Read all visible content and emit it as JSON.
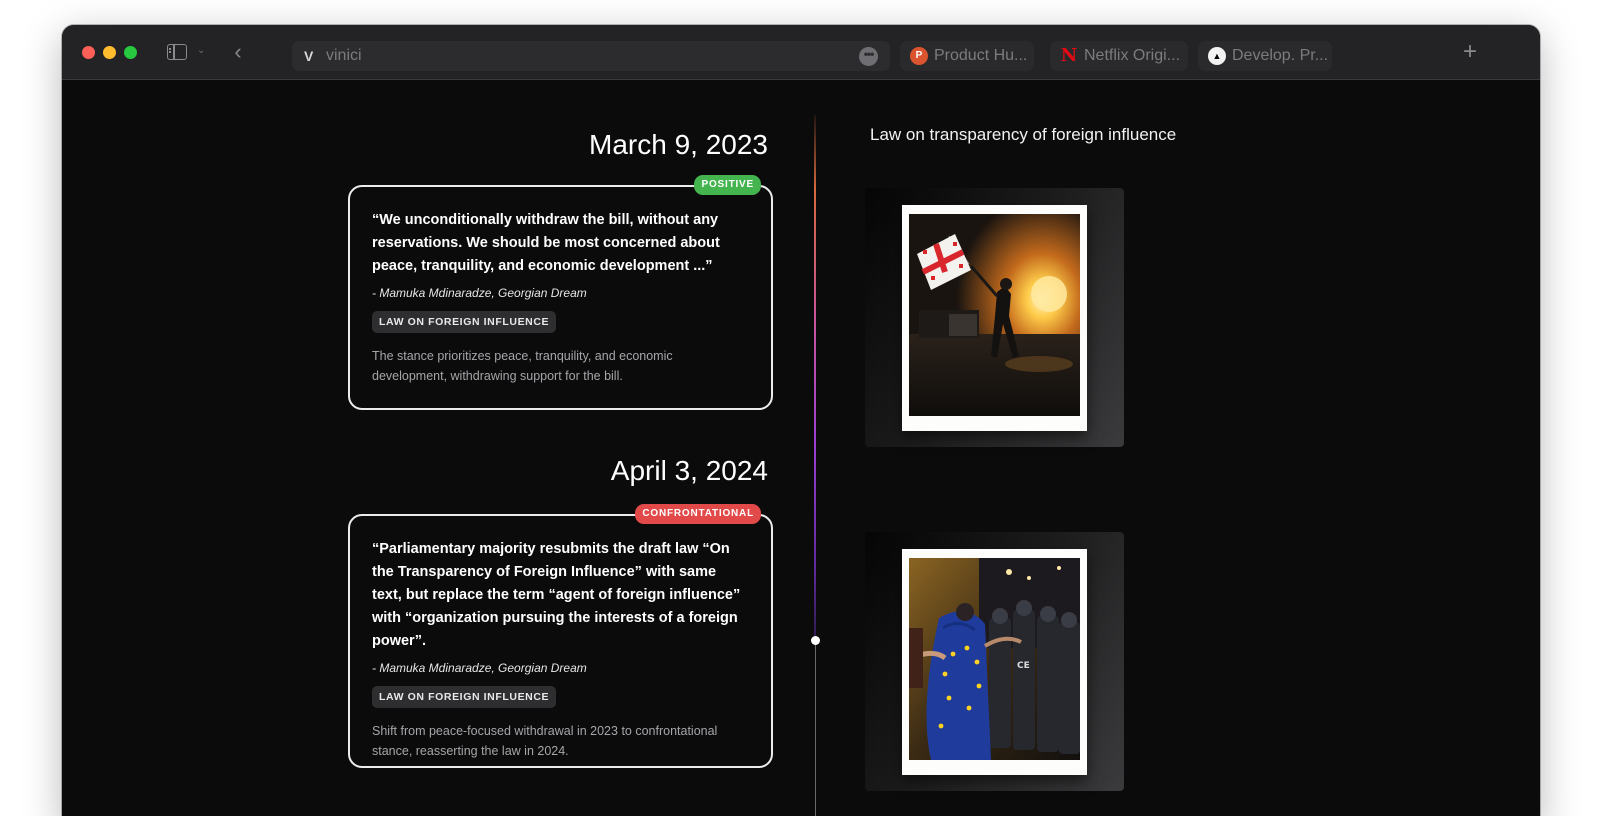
{
  "browser": {
    "address": "vinici",
    "site_icon": "V",
    "tabs": [
      {
        "label": "Product Hu...",
        "icon": "P",
        "icon_name": "product-hunt-icon",
        "color": "#da552f"
      },
      {
        "label": "Netflix Origi...",
        "icon": "N",
        "icon_name": "netflix-icon",
        "color": "#e50914"
      },
      {
        "label": "Develop. Pr...",
        "icon": "▲",
        "icon_name": "vercel-icon",
        "color": "#000000"
      }
    ],
    "new_tab": "+",
    "back": "‹",
    "more": "•••"
  },
  "section": {
    "title": "Law on transparency of foreign influence"
  },
  "entries": [
    {
      "date": "March 9, 2023",
      "badge": "POSITIVE",
      "badge_color": "#44b44e",
      "quote": "“We unconditionally withdraw the bill, without any reservations. We should be most concerned about peace, tranquility, and economic development ...”",
      "author": "- Mamuka Mdinaradze, Georgian Dream",
      "tag": "LAW ON FOREIGN INFLUENCE",
      "summary": "The stance prioritizes peace, tranquility, and economic development, withdrawing support for the bill."
    },
    {
      "date": "April 3, 2024",
      "badge": "CONFRONTATIONAL",
      "badge_color": "#e24a4a",
      "quote": "“Parliamentary majority resubmits the draft law “On the Transparency of Foreign Influence” with same text, but replace the term “agent of foreign influence” with “organization pursuing the interests of a foreign power”.",
      "author": "- Mamuka Mdinaradze, Georgian Dream",
      "tag": "LAW ON FOREIGN INFLUENCE",
      "summary": "Shift from peace-focused withdrawal in 2023 to confrontational stance, reasserting the law in 2024."
    }
  ]
}
